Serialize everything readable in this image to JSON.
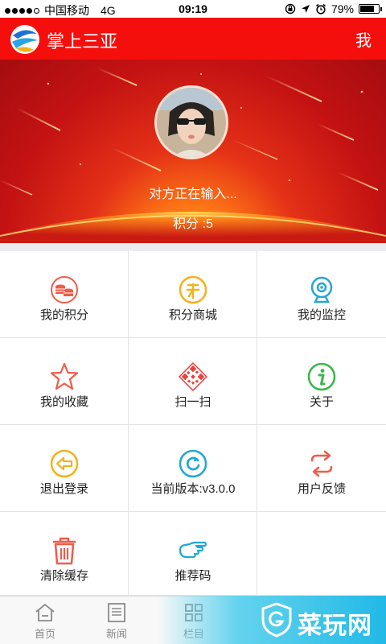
{
  "status_bar": {
    "carrier": "中国移动",
    "network": "4G",
    "time": "09:19",
    "battery": "79%",
    "battery_level": 0.79
  },
  "header": {
    "title": "掌上三亚",
    "me_label": "我"
  },
  "profile": {
    "status": "对方正在输入...",
    "points": "积分 :5"
  },
  "menu": [
    {
      "label": "我的积分",
      "icon": "coins-icon",
      "color": "#f05b4a"
    },
    {
      "label": "积分商城",
      "icon": "yuan-coin-icon",
      "color": "#f3b21b"
    },
    {
      "label": "我的监控",
      "icon": "camera-icon",
      "color": "#22a7d5"
    },
    {
      "label": "我的收藏",
      "icon": "star-icon",
      "color": "#f05b4a"
    },
    {
      "label": "扫一扫",
      "icon": "qr-code-icon",
      "color": "#e8413b"
    },
    {
      "label": "关于",
      "icon": "info-icon",
      "color": "#3bb54a"
    },
    {
      "label": "退出登录",
      "icon": "logout-arrow-icon",
      "color": "#f3b21b"
    },
    {
      "label": "当前版本:v3.0.0",
      "icon": "refresh-icon",
      "color": "#22a7d5"
    },
    {
      "label": "用户反馈",
      "icon": "swap-arrows-icon",
      "color": "#f05b4a"
    },
    {
      "label": "清除缓存",
      "icon": "trash-icon",
      "color": "#f05b4a"
    },
    {
      "label": "推荐码",
      "icon": "pointing-hand-icon",
      "color": "#22a7d5"
    }
  ],
  "tabs": [
    {
      "label": "首页",
      "icon": "home-icon"
    },
    {
      "label": "新闻",
      "icon": "news-icon"
    },
    {
      "label": "栏目",
      "icon": "grid-icon"
    }
  ],
  "watermark": {
    "text": "菜玩网"
  }
}
